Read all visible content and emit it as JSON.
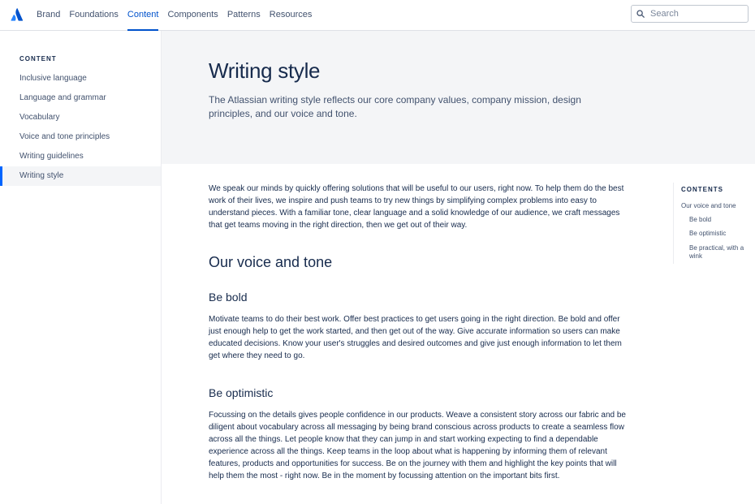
{
  "header": {
    "nav": [
      {
        "label": "Brand"
      },
      {
        "label": "Foundations"
      },
      {
        "label": "Content"
      },
      {
        "label": "Components"
      },
      {
        "label": "Patterns"
      },
      {
        "label": "Resources"
      }
    ],
    "active_nav": "Content",
    "search_placeholder": "Search",
    "search_value": ""
  },
  "sidebar": {
    "heading": "CONTENT",
    "items": [
      {
        "label": "Inclusive language"
      },
      {
        "label": "Language and grammar"
      },
      {
        "label": "Vocabulary"
      },
      {
        "label": "Voice and tone principles"
      },
      {
        "label": "Writing guidelines"
      },
      {
        "label": "Writing style"
      }
    ],
    "active_item": "Writing style"
  },
  "hero": {
    "title": "Writing style",
    "subtitle": "The Atlassian writing style reflects our core company values, company mission, design principles, and our voice and tone."
  },
  "main": {
    "intro": "We speak our minds by quickly offering solutions that will be useful to our users, right now. To help them do the best work of their lives, we inspire and push teams to try new things by simplifying complex problems into easy to understand pieces. With a familiar tone, clear language and a solid knowledge of our audience, we craft messages that get teams moving in the right direction, then we get out of their way.",
    "section_title": "Our voice and tone",
    "be_bold": {
      "title": "Be bold",
      "body": "Motivate teams to do their best work. Offer best practices to get users going in the right direction. Be bold and offer just enough help to get the work started, and then get out of the way. Give accurate information so users can make educated decisions. Know your user's struggles and desired outcomes and give just enough information to let them get where they need to go."
    },
    "be_optimistic": {
      "title": "Be optimistic",
      "body": "Focussing on the details gives people confidence in our products. Weave a consistent story across our fabric and be diligent about vocabulary across all messaging by being brand conscious across products to create a seamless flow across all the things. Let people know that they can jump in and start working expecting to find a dependable experience across all the things. Keep teams in the loop about what is happening by informing them of relevant features, products and opportunities for success. Be on the journey with them and highlight the key points that will help them the most - right now. Be in the moment by focussing attention on the important bits first."
    }
  },
  "toc": {
    "heading": "CONTENTS",
    "items": [
      {
        "label": "Our voice and tone"
      },
      {
        "label": "Be bold"
      },
      {
        "label": "Be optimistic"
      },
      {
        "label": "Be practical, with a wink"
      }
    ]
  },
  "colors": {
    "brand_blue": "#0052CC",
    "active_border": "#0065FF",
    "text_primary": "#172B4D",
    "text_secondary": "#42526E",
    "hero_bg": "#F4F5F7"
  },
  "icons": {
    "logo": "atlassian-logo-icon",
    "search": "search-icon"
  }
}
